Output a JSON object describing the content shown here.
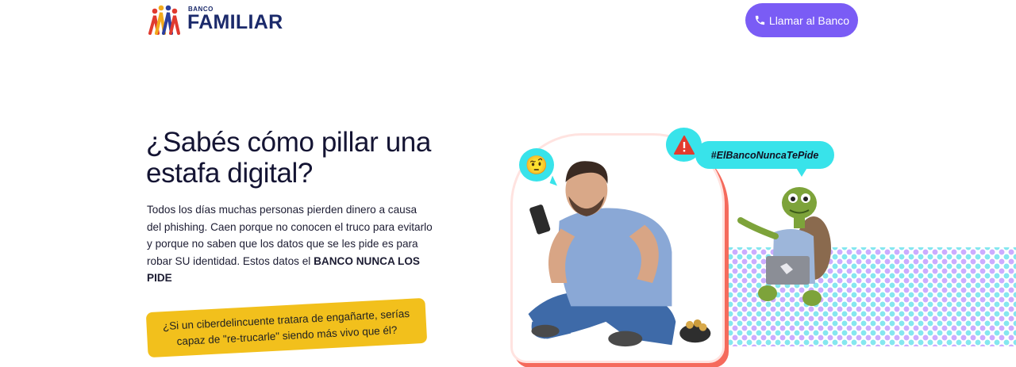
{
  "header": {
    "logo_small": "BANCO",
    "logo_big": "FAMILIAR",
    "call_button_label": "Llamar al Banco",
    "call_button_icon": "phone-icon",
    "accent_color": "#7a5cf5"
  },
  "hero": {
    "title": "¿Sabés cómo pillar una estafa digital?",
    "body_text": "Todos los días muchas personas pierden dinero a causa del phishing. Caen porque no conocen el truco para evitarlo y porque no saben que los datos que se les pide es para robar SU identidad. Estos datos el ",
    "body_bold": "BANCO NUNCA LOS PIDE",
    "callout": "¿Si un ciberdelincuente tratara de engañarte, serías capaz de \"re-trucarle\" siendo más vivo que él?",
    "callout_color": "#f2c01c"
  },
  "illustration": {
    "hashtag": "#ElBancoNuncaTePide",
    "emoji_bubble_icon": "raised-eyebrow-emoji-icon",
    "warning_icon": "warning-icon",
    "bubble_color": "#38e3ea"
  }
}
